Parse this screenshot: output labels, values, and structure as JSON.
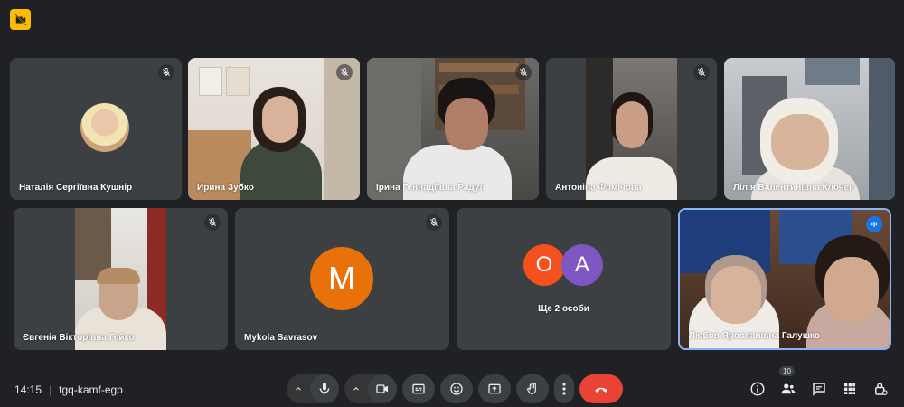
{
  "meeting": {
    "time": "14:15",
    "code": "tgq-kamf-egp",
    "participant_count": "10"
  },
  "tiles": [
    {
      "name": "Наталія Сергіївна Кушнір"
    },
    {
      "name": "Ирина Зубко"
    },
    {
      "name": "Ірина Геннадіївна Радул"
    },
    {
      "name": "Антоніна Фомічова"
    },
    {
      "name": "Лілія Валентинівна Клочек"
    },
    {
      "name": "Євгенія Вікторівна Гейко"
    },
    {
      "name": "Mykola Savrasov",
      "initial": "M"
    },
    {
      "name": "Ще 2 особи",
      "initials": [
        "O",
        "A"
      ]
    },
    {
      "name": "Любов Ярославівна Галушко"
    }
  ],
  "colors": {
    "background": "#202124",
    "tile": "#3c4043",
    "accent": "#1a73e8",
    "hangup": "#ea4335",
    "avatar_orange": "#e8710a",
    "avatar_red": "#f4511e",
    "avatar_purple": "#7e57c2",
    "badge": "#fbbc04"
  },
  "icons": [
    "camera-off-icon",
    "mic-off-icon",
    "audio-active-icon",
    "mic-icon",
    "camera-icon",
    "captions-icon",
    "emoji-icon",
    "present-icon",
    "raise-hand-icon",
    "more-options-icon",
    "hangup-icon",
    "info-icon",
    "people-icon",
    "chat-icon",
    "activities-icon",
    "host-controls-icon",
    "chevron-up-icon"
  ]
}
